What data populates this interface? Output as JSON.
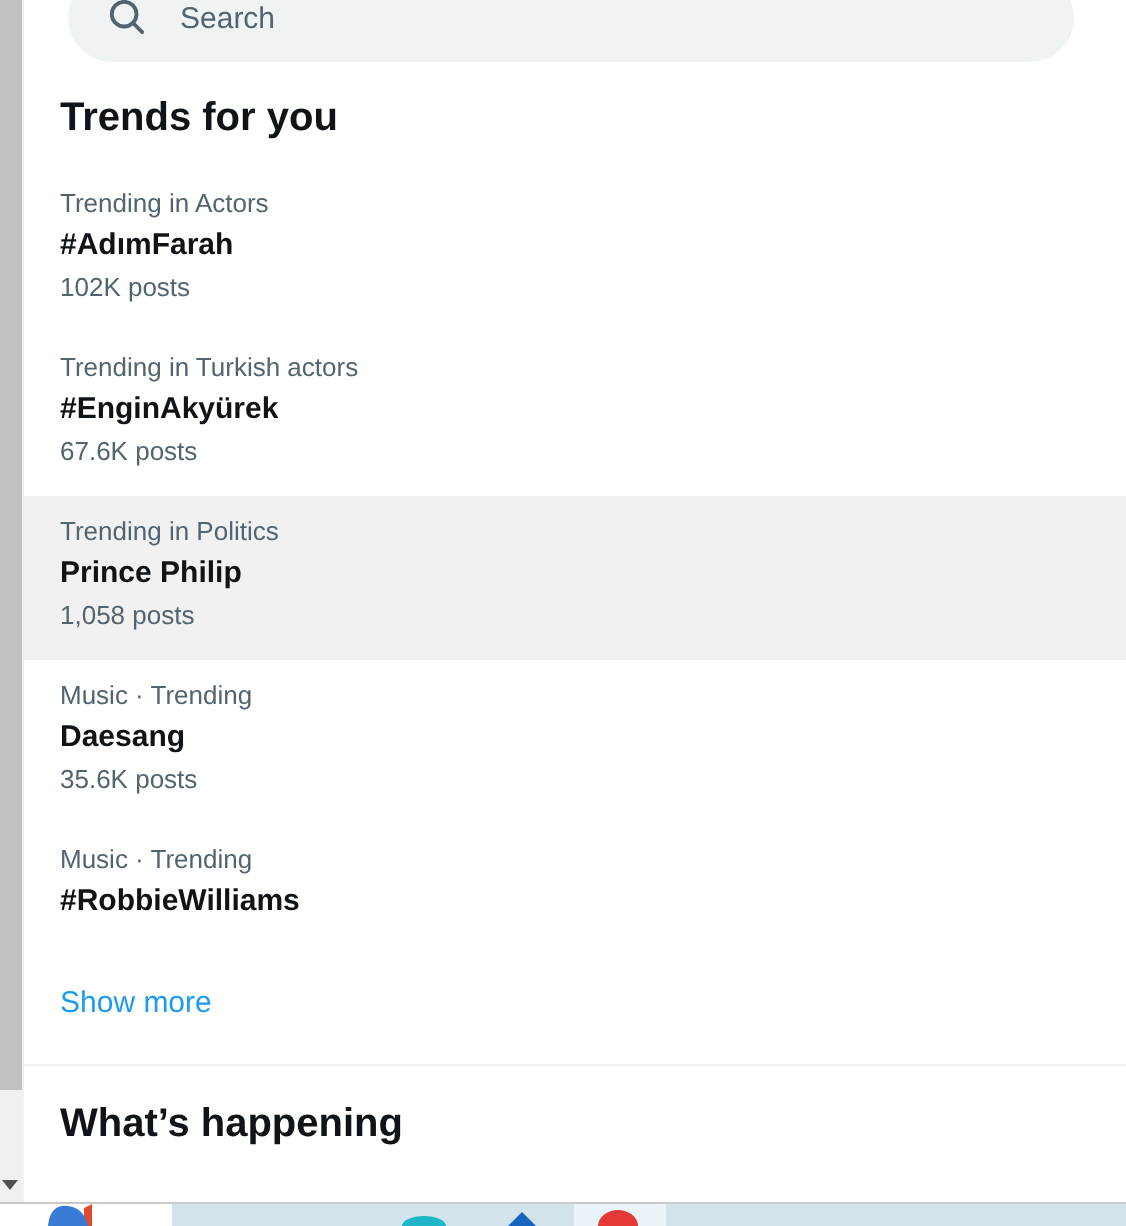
{
  "search": {
    "placeholder": "Search"
  },
  "trends_section": {
    "title": "Trends for you",
    "items": [
      {
        "category": "Trending in Actors",
        "name": "#AdımFarah",
        "posts": "102K posts",
        "highlighted": false
      },
      {
        "category": "Trending in Turkish actors",
        "name": "#EnginAkyürek",
        "posts": "67.6K posts",
        "highlighted": false
      },
      {
        "category": "Trending in Politics",
        "name": "Prince Philip",
        "posts": "1,058 posts",
        "highlighted": true
      },
      {
        "category": "Music · Trending",
        "name": "Daesang",
        "posts": "35.6K posts",
        "highlighted": false
      },
      {
        "category": "Music · Trending",
        "name": "#RobbieWilliams",
        "highlighted": false
      }
    ],
    "show_more": "Show more"
  },
  "happening_section": {
    "title": "What’s happening"
  }
}
